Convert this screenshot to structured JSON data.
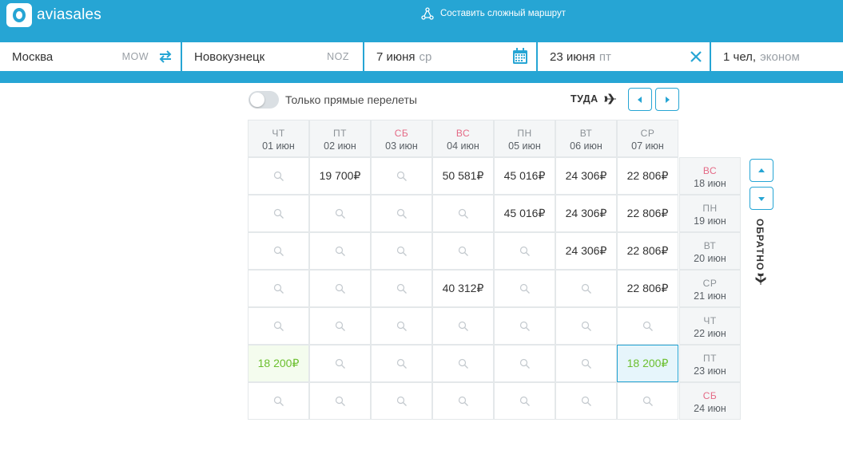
{
  "header": {
    "logo_text": "aviasales",
    "complex_route": "Составить сложный маршрут"
  },
  "search": {
    "origin": {
      "city": "Москва",
      "iata": "MOW"
    },
    "destination": {
      "city": "Новокузнецк",
      "iata": "NOZ"
    },
    "depart": {
      "date": "7 июня",
      "dow": "ср"
    },
    "return": {
      "date": "23 июня",
      "dow": "пт"
    },
    "passengers": {
      "count": "1 чел,",
      "cabin": "эконом"
    }
  },
  "filters": {
    "direct_only": "Только прямые перелеты",
    "direct_only_on": false
  },
  "matrix": {
    "outbound_label": "ТУДА",
    "return_label": "ОБРАТНО",
    "columns": [
      {
        "dow": "ЧТ",
        "date": "01 июн",
        "weekend": false
      },
      {
        "dow": "ПТ",
        "date": "02 июн",
        "weekend": false
      },
      {
        "dow": "СБ",
        "date": "03 июн",
        "weekend": true
      },
      {
        "dow": "ВС",
        "date": "04 июн",
        "weekend": true
      },
      {
        "dow": "ПН",
        "date": "05 июн",
        "weekend": false
      },
      {
        "dow": "ВТ",
        "date": "06 июн",
        "weekend": false
      },
      {
        "dow": "СР",
        "date": "07 июн",
        "weekend": false
      }
    ],
    "rows": [
      {
        "dow": "ВС",
        "date": "18 июн",
        "weekend": true,
        "prices": [
          "",
          "19 700₽",
          "",
          "50 581₽",
          "45 016₽",
          "24 306₽",
          "22 806₽"
        ]
      },
      {
        "dow": "ПН",
        "date": "19 июн",
        "weekend": false,
        "prices": [
          "",
          "",
          "",
          "",
          "45 016₽",
          "24 306₽",
          "22 806₽"
        ]
      },
      {
        "dow": "ВТ",
        "date": "20 июн",
        "weekend": false,
        "prices": [
          "",
          "",
          "",
          "",
          "",
          "24 306₽",
          "22 806₽"
        ]
      },
      {
        "dow": "СР",
        "date": "21 июн",
        "weekend": false,
        "prices": [
          "",
          "",
          "",
          "40 312₽",
          "",
          "",
          "22 806₽"
        ]
      },
      {
        "dow": "ЧТ",
        "date": "22 июн",
        "weekend": false,
        "prices": [
          "",
          "",
          "",
          "",
          "",
          "",
          ""
        ]
      },
      {
        "dow": "ПТ",
        "date": "23 июн",
        "weekend": false,
        "prices": [
          "18 200₽",
          "",
          "",
          "",
          "",
          "",
          "18 200₽"
        ]
      },
      {
        "dow": "СБ",
        "date": "24 июн",
        "weekend": true,
        "prices": [
          "",
          "",
          "",
          "",
          "",
          "",
          ""
        ]
      }
    ],
    "cheapest_cells": [
      [
        5,
        0
      ]
    ],
    "selected_cell": [
      5,
      6
    ]
  },
  "colors": {
    "brand": "#26a5d4",
    "weekend": "#e46a86",
    "cheap": "#6bbf2e"
  }
}
